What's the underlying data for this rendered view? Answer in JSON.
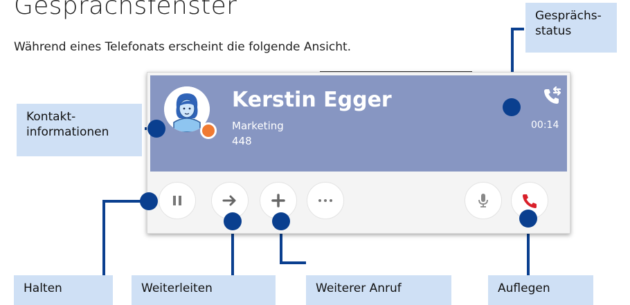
{
  "page": {
    "title": "Gesprächsfenster",
    "intro": "Während eines Telefonats erscheint die folgende Ansicht."
  },
  "call": {
    "contact_name": "Kerstin Egger",
    "department": "Marketing",
    "number": "448",
    "duration": "00:14",
    "presence_color": "#f07a32",
    "header_color": "#8796c2"
  },
  "controls": {
    "hold_icon": "pause-icon",
    "forward_icon": "arrow-right-icon",
    "add_call_icon": "plus-icon",
    "more_icon": "more-dots-icon",
    "mute_icon": "microphone-icon",
    "hangup_icon": "hangup-icon"
  },
  "callouts": {
    "status": "Gesprächs-\nstatus",
    "contact": "Kontakt-\ninformationen",
    "hold": "Halten",
    "forward": "Weiterleiten",
    "add_call": "Weiterer Anruf",
    "hangup": "Auflegen"
  },
  "colors": {
    "accent": "#0a3f8f",
    "callout_bg": "#cfe0f5",
    "hangup_red": "#d9202a"
  }
}
